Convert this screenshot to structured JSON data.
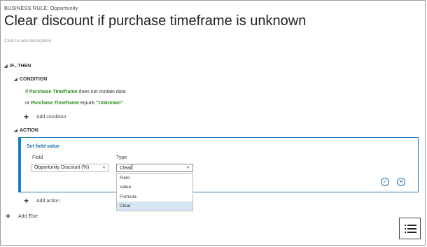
{
  "header": {
    "entity": "BUSINESS RULE: Opportunity",
    "title": "Clear discount if purchase timeframe is unknown",
    "description_placeholder": "Click to add description"
  },
  "if_then": {
    "label": "IF...THEN",
    "condition": {
      "label": "CONDITION",
      "lines": [
        {
          "prefix": "If",
          "field": "Purchase Timeframe",
          "operator": "does not contain data",
          "value": ""
        },
        {
          "prefix": "or",
          "field": "Purchase Timeframe",
          "operator": "equals",
          "value": "\"Unknown\""
        }
      ],
      "add_label": "Add condition"
    },
    "action": {
      "label": "ACTION",
      "card": {
        "title": "Set field value",
        "field_label": "Field",
        "field_value": "Opportunity Discount (%)",
        "type_label": "Type",
        "type_value": "Clear",
        "type_options": [
          "Field",
          "Value",
          "Formula",
          "Clear"
        ],
        "selected_option": "Clear"
      },
      "add_label": "Add action"
    }
  },
  "add_else_label": "Add Else",
  "icons": {
    "expand": "collapse-triangle-icon",
    "add": "plus-icon",
    "confirm": "checkmark-icon",
    "cancel": "close-icon",
    "list": "list-icon"
  },
  "colors": {
    "accent": "#1f7fbf",
    "field_green": "#2b8a1c",
    "selected_option_bg": "#d6e6f4"
  }
}
